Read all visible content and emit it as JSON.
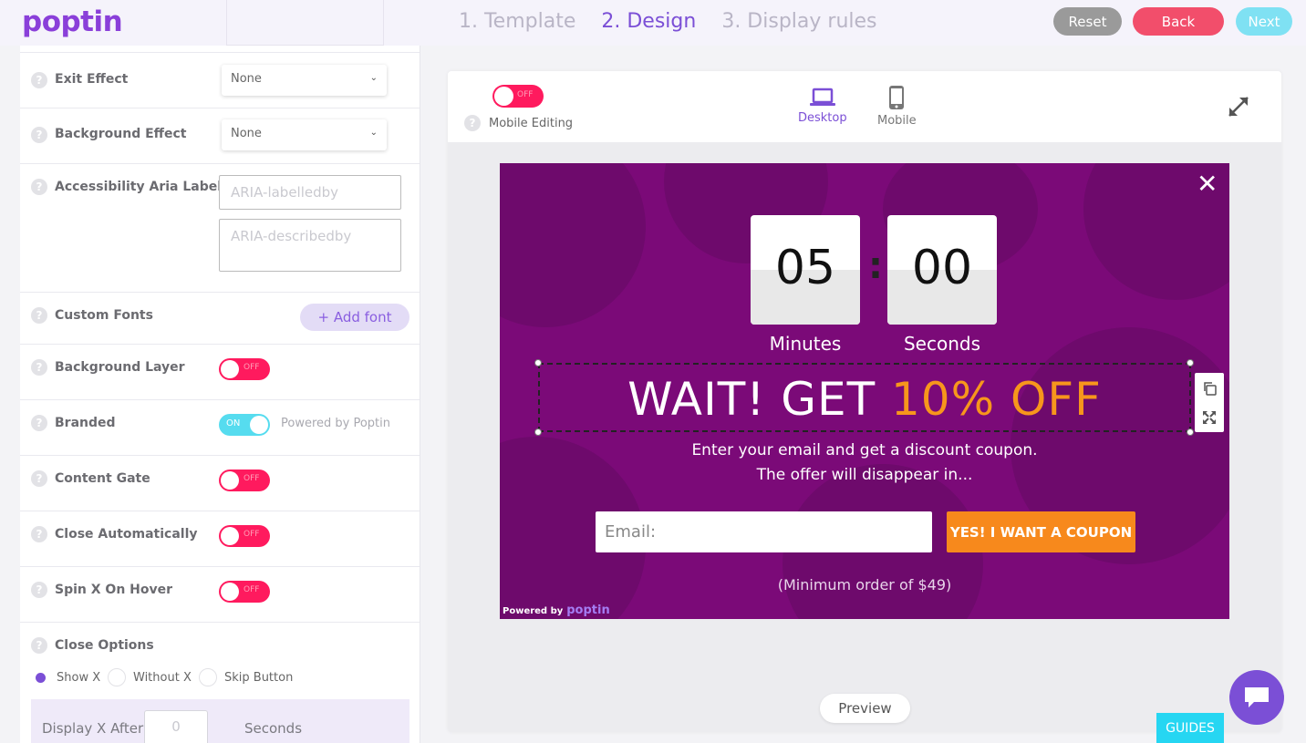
{
  "app": {
    "logo": "poptin"
  },
  "steps": [
    {
      "label": "1. Template"
    },
    {
      "label": "2. Design"
    },
    {
      "label": "3. Display rules"
    }
  ],
  "top_buttons": {
    "reset": "Reset",
    "back": "Back",
    "next": "Next"
  },
  "settings": {
    "exit_effect": {
      "label": "Exit Effect",
      "value": "None"
    },
    "background_effect": {
      "label": "Background Effect",
      "value": "None"
    },
    "aria": {
      "label": "Accessibility Aria Labels",
      "labelledby_placeholder": "ARIA-labelledby",
      "describedby_placeholder": "ARIA-describedby"
    },
    "custom_fonts": {
      "label": "Custom Fonts",
      "button": "+ Add font"
    },
    "background_layer": {
      "label": "Background Layer",
      "state": "OFF"
    },
    "branded": {
      "label": "Branded",
      "state": "ON",
      "note": "Powered by Poptin"
    },
    "content_gate": {
      "label": "Content Gate",
      "state": "OFF"
    },
    "close_automatically": {
      "label": "Close Automatically",
      "state": "OFF"
    },
    "spin_x": {
      "label": "Spin X On Hover",
      "state": "OFF"
    },
    "close_options": {
      "label": "Close Options",
      "options": [
        "Show X",
        "Without X",
        "Skip Button"
      ],
      "selected": "Show X"
    },
    "display_x": {
      "label": "Display X After",
      "value": "0",
      "unit": "Seconds"
    }
  },
  "editor": {
    "mobile_editing": {
      "label": "Mobile Editing",
      "state": "OFF"
    },
    "devices": {
      "desktop": "Desktop",
      "mobile": "Mobile"
    },
    "preview": "Preview"
  },
  "popup": {
    "minutes": "05",
    "seconds": "00",
    "minutes_label": "Minutes",
    "seconds_label": "Seconds",
    "colon": ":",
    "headline_main": "WAIT! GET ",
    "headline_accent": "10% OFF",
    "sub_line1": "Enter your email and get a discount coupon.",
    "sub_line2": "The offer will disappear in...",
    "email_placeholder": "Email:",
    "cta": "YES! I WANT A COUPON",
    "min_order": "(Minimum order of $49)",
    "powered_by": "Powered by",
    "powered_logo": "poptin",
    "close": "✕"
  },
  "guides": "GUIDES",
  "colors": {
    "accent": "#7b4fd6",
    "popup_bg": "#7b0a78",
    "cta": "#f7891c",
    "toggle_off": "#ff1a5e",
    "toggle_on": "#56dcef"
  }
}
